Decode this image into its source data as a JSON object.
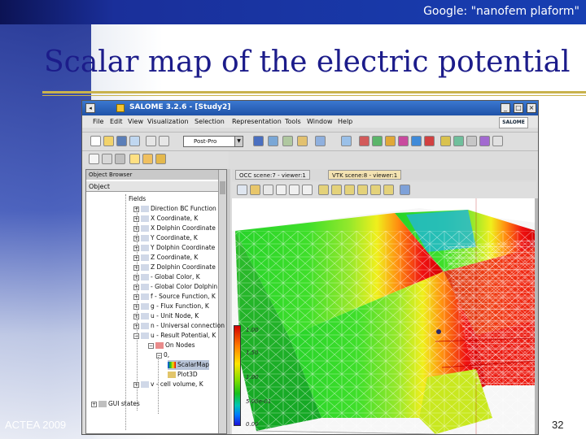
{
  "slide": {
    "header_note": "Google: \"nanofem plaform\"",
    "title": "Scalar map of the electric potential",
    "footer_left": "ACTEA 2009",
    "page_number": "32"
  },
  "window": {
    "title": "SALOME 3.2.6 - [Study2]",
    "brand": "SALOME",
    "buttons": [
      "_",
      "□",
      "×"
    ]
  },
  "menubar": [
    "File",
    "Edit",
    "View",
    "Visualization",
    "Selection",
    "Representation",
    "Tools",
    "Window",
    "Help"
  ],
  "toolbar": {
    "module_select": "Post-Pro"
  },
  "object_browser": {
    "title": "Object Browser",
    "header": "Object",
    "items": [
      {
        "label": "Fields"
      },
      {
        "label": "Direction BC Function"
      },
      {
        "label": "X Coordinate, K"
      },
      {
        "label": "X Dolphin Coordinate"
      },
      {
        "label": "Y Coordinate, K"
      },
      {
        "label": "Y Dolphin Coordinate"
      },
      {
        "label": "Z Coordinate, K"
      },
      {
        "label": "Z Dolphin Coordinate"
      },
      {
        "label": "- Global Color, K"
      },
      {
        "label": "- Global Color Dolphin"
      },
      {
        "label": "f - Source Function, K"
      },
      {
        "label": "g - Flux Function, K"
      },
      {
        "label": "u - Unit Node, K"
      },
      {
        "label": "n - Universal connection"
      },
      {
        "label": "u - Result Potential, K"
      },
      {
        "label": "On Nodes"
      },
      {
        "label": "0,"
      },
      {
        "label": "ScalarMap"
      },
      {
        "label": "Plot3D"
      },
      {
        "label": "v - cell volume, K"
      },
      {
        "label": "GUI states"
      }
    ]
  },
  "viewer": {
    "tabs": [
      "OCC scene:7 - viewer:1",
      "VTK scene:8 - viewer:1"
    ],
    "legend_labels": [
      "1.00",
      "1.50",
      "1.00",
      "5.00e-01",
      "0.00"
    ]
  },
  "colors": {
    "slide_blue": "#1a2f9a",
    "title_text": "#1c1c8a",
    "rule_gold": "#c9b24d",
    "window_title": "#1f52a8"
  }
}
